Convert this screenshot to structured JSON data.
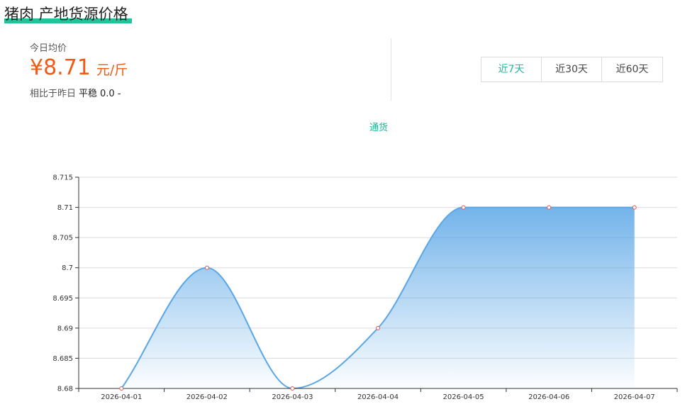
{
  "page": {
    "title": "猪肉 产地货源价格"
  },
  "summary": {
    "today_label": "今日均价",
    "price_value": "¥8.71",
    "price_unit": "元/斤",
    "compare_label": "相比于昨日",
    "compare_status": "平稳",
    "compare_delta": "0.0",
    "compare_arrow": "-"
  },
  "range_tabs": [
    {
      "label": "近7天",
      "active": true
    },
    {
      "label": "近30天",
      "active": false
    },
    {
      "label": "近60天",
      "active": false
    }
  ],
  "colors": {
    "accent": "#26b49a",
    "price": "#f05a14",
    "line": "#5aa6e6",
    "point": "#e05656"
  },
  "chart_data": {
    "type": "area",
    "legend": [
      "通货"
    ],
    "x": [
      "2026-04-01",
      "2026-04-02",
      "2026-04-03",
      "2026-04-04",
      "2026-04-05",
      "2026-04-06",
      "2026-04-07"
    ],
    "series": [
      {
        "name": "通货",
        "values": [
          8.68,
          8.7,
          8.68,
          8.69,
          8.71,
          8.71,
          8.71
        ]
      }
    ],
    "yticks": [
      "8.68",
      "8.685",
      "8.69",
      "8.695",
      "8.7",
      "8.705",
      "8.71",
      "8.715"
    ],
    "ylim": [
      8.68,
      8.715
    ],
    "grid": true,
    "smooth": true
  }
}
